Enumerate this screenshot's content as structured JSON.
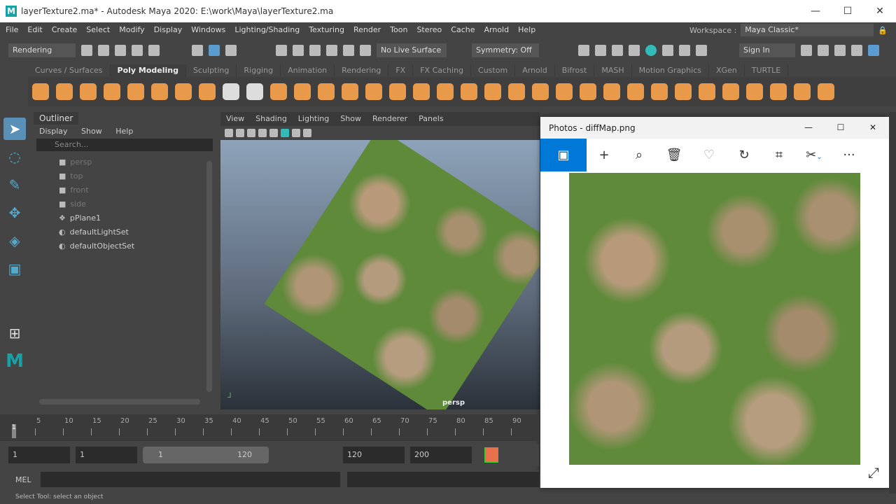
{
  "window": {
    "title": "layerTexture2.ma* - Autodesk Maya 2020: E:\\work\\Maya\\layerTexture2.ma",
    "logo": "M",
    "min": "—",
    "max": "☐",
    "close": "✕"
  },
  "menubar": [
    "File",
    "Edit",
    "Create",
    "Select",
    "Modify",
    "Display",
    "Windows",
    "Lighting/Shading",
    "Texturing",
    "Render",
    "Toon",
    "Stereo",
    "Cache",
    "Arnold",
    "Help"
  ],
  "workspace": {
    "label": "Workspace :",
    "value": "Maya Classic*"
  },
  "statusline": {
    "menuset": "Rendering",
    "live_surface": "No Live Surface",
    "symmetry": "Symmetry: Off",
    "sign_in": "Sign In"
  },
  "shelf_tabs": [
    "Curves / Surfaces",
    "Poly Modeling",
    "Sculpting",
    "Rigging",
    "Animation",
    "Rendering",
    "FX",
    "FX Caching",
    "Custom",
    "Arnold",
    "Bifrost",
    "MASH",
    "Motion Graphics",
    "XGen",
    "TURTLE"
  ],
  "outliner": {
    "title": "Outliner",
    "menus": [
      "Display",
      "Show",
      "Help"
    ],
    "search_placeholder": "Search...",
    "items": [
      {
        "label": "persp",
        "dim": true
      },
      {
        "label": "top",
        "dim": true
      },
      {
        "label": "front",
        "dim": true
      },
      {
        "label": "side",
        "dim": true
      },
      {
        "label": "pPlane1"
      },
      {
        "label": "defaultLightSet"
      },
      {
        "label": "defaultObjectSet"
      }
    ]
  },
  "viewport": {
    "menus": [
      "View",
      "Shading",
      "Lighting",
      "Show",
      "Renderer",
      "Panels"
    ],
    "camera_label": "persp"
  },
  "photos": {
    "title": "Photos - diffMap.png",
    "more": "···"
  },
  "timeline": {
    "ticks": [
      "5",
      "10",
      "15",
      "20",
      "25",
      "30",
      "35",
      "40",
      "45",
      "50",
      "55",
      "60",
      "65",
      "70",
      "75",
      "80",
      "85",
      "90"
    ],
    "current": "1"
  },
  "range": {
    "start": "1",
    "playback_start": "1",
    "slider_start": "1",
    "slider_end": "120",
    "playback_end": "120",
    "end": "200"
  },
  "mel": {
    "label": "MEL"
  },
  "help_line": "Select Tool: select an object",
  "colors": {
    "accent": "#0078d7",
    "maya_teal": "#16a3a8",
    "shelf_orange": "#e89a4a"
  }
}
